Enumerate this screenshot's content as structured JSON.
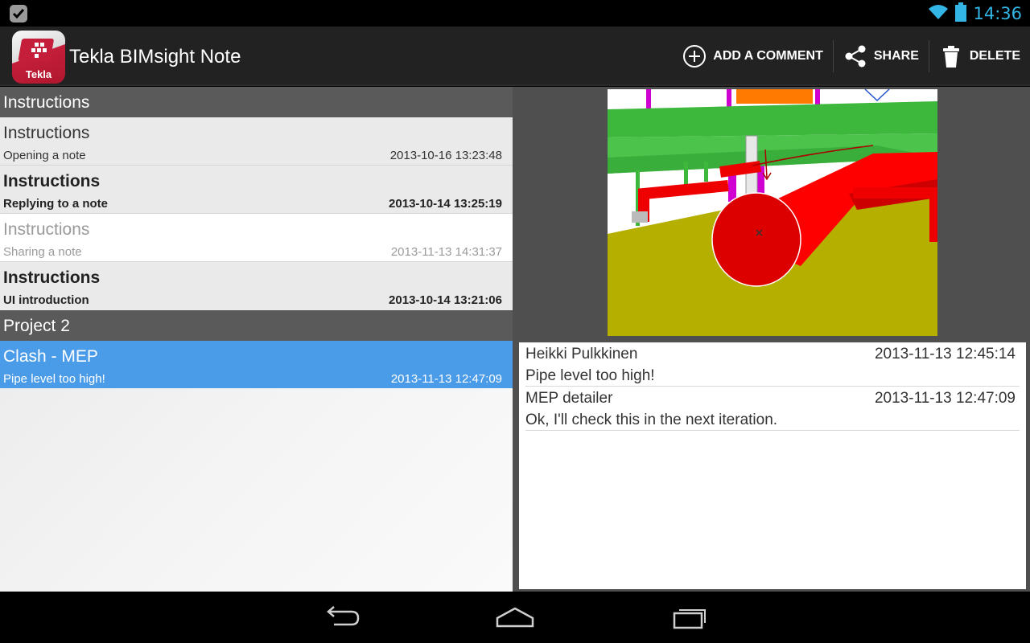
{
  "status_bar": {
    "time": "14:36",
    "notification_icon": "checkbox-notification-icon",
    "wifi_icon": "wifi-icon",
    "battery_icon": "battery-icon",
    "accent_color": "#33b5e5"
  },
  "action_bar": {
    "app_icon_label": "Tekla",
    "app_title": "Tekla BIMsight Note",
    "add_comment_label": "ADD A COMMENT",
    "share_label": "SHARE",
    "delete_label": "DELETE"
  },
  "notes": {
    "groups": [
      {
        "name": "Instructions",
        "items": [
          {
            "title": "Instructions",
            "subtitle": "Opening a note",
            "date": "2013-10-16 13:23:48"
          },
          {
            "title": "Instructions",
            "subtitle": "Replying to a note",
            "date": "2013-10-14 13:25:19"
          },
          {
            "title": "Instructions",
            "subtitle": "Sharing a note",
            "date": "2013-11-13 14:31:37"
          },
          {
            "title": "Instructions",
            "subtitle": "UI introduction",
            "date": "2013-10-14 13:21:06"
          }
        ]
      },
      {
        "name": "Project 2",
        "items": [
          {
            "title": "Clash - MEP",
            "subtitle": "Pipe level too high!",
            "date": "2013-11-13 12:47:09"
          }
        ]
      }
    ],
    "selected_color": "#4a9be8"
  },
  "comments": [
    {
      "author": "Heikki Pulkkinen",
      "date": "2013-11-13 12:45:14",
      "text": "Pipe level too high!"
    },
    {
      "author": "MEP detailer",
      "date": "2013-11-13 12:47:09",
      "text": "Ok, I'll check this in the next iteration."
    }
  ],
  "nav_bar": {
    "back_icon": "back-icon",
    "home_icon": "home-icon",
    "recents_icon": "recents-icon"
  }
}
